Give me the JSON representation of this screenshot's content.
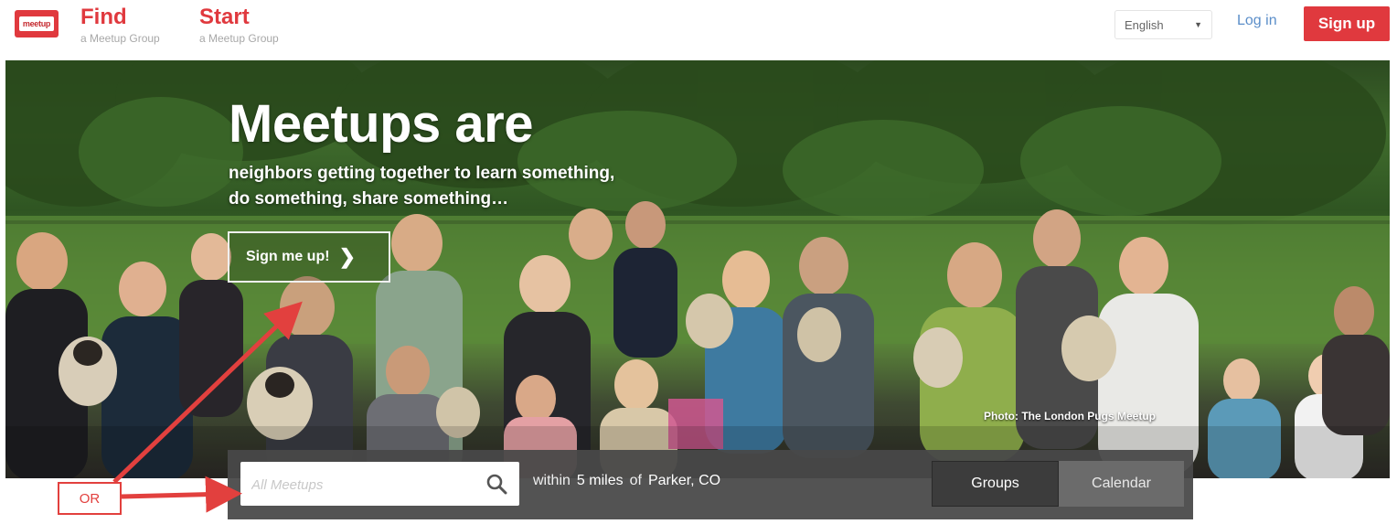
{
  "header": {
    "logo_text": "meetup",
    "find": {
      "title": "Find",
      "subtitle": "a Meetup Group"
    },
    "start": {
      "title": "Start",
      "subtitle": "a Meetup Group"
    },
    "language": {
      "selected": "English"
    },
    "login_label": "Log in",
    "signup_label": "Sign up"
  },
  "hero": {
    "title": "Meetups are",
    "subtitle_line1": "neighbors getting together to learn something,",
    "subtitle_line2": "do something, share something…",
    "cta_label": "Sign me up!",
    "photo_credit": "Photo: The London Pugs Meetup"
  },
  "search": {
    "placeholder": "All Meetups",
    "within_label": "within",
    "distance": "5 miles",
    "of_label": "of",
    "location": "Parker, CO",
    "tabs": [
      {
        "label": "Groups",
        "active": true
      },
      {
        "label": "Calendar",
        "active": false
      }
    ]
  },
  "annotation": {
    "label": "OR",
    "color": "#e2403e"
  },
  "colors": {
    "brand": "#e0393e",
    "link": "#5b8ec9",
    "search_bar": "#484848"
  },
  "icons": {
    "search": "search-icon",
    "cta": "chevron-right-icon",
    "select": "caret-down-icon"
  }
}
